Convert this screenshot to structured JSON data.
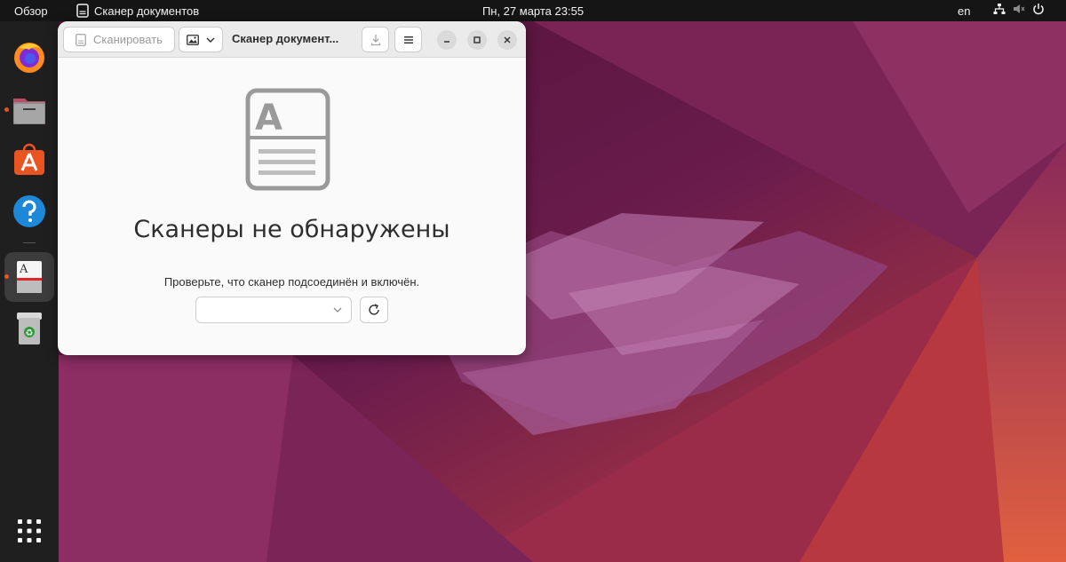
{
  "topbar": {
    "activities_label": "Обзор",
    "app_label": "Сканер документов",
    "clock": "Пн, 27 марта  23:55",
    "language": "en",
    "tray_icons": [
      "network-icon",
      "volume-muted-icon",
      "power-icon"
    ]
  },
  "dock": {
    "items": [
      {
        "name": "firefox",
        "icon": "firefox-icon",
        "running": false
      },
      {
        "name": "files",
        "icon": "files-icon",
        "running": true
      },
      {
        "name": "app-center",
        "icon": "app-center-icon",
        "running": false
      },
      {
        "name": "help",
        "icon": "help-icon",
        "running": false
      },
      {
        "name": "document-scanner",
        "icon": "scanner-icon",
        "running": true,
        "active": true
      },
      {
        "name": "trash",
        "icon": "trash-icon",
        "running": false
      }
    ],
    "apps_grid_icon": "apps-grid-icon"
  },
  "window": {
    "scan_label": "Сканировать",
    "title": "Сканер документ...",
    "status_title": "Сканеры не обнаружены",
    "status_description": "Проверьте, что сканер подсоединён и включён.",
    "device_selected": ""
  },
  "colors": {
    "accent": "#e95420",
    "topbar_bg": "#151515",
    "dock_bg": "#1f1f1f",
    "window_bg": "#fafafa",
    "headerbar_bg": "#ebebeb"
  }
}
